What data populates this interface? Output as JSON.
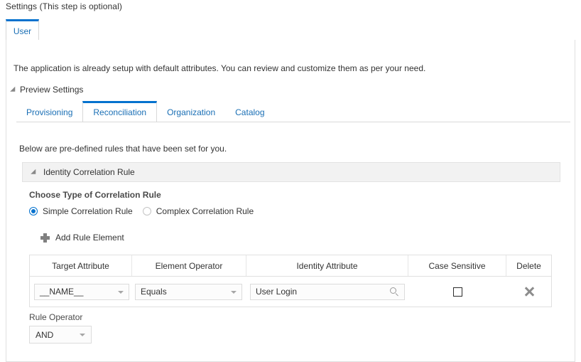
{
  "page": {
    "title": "Settings (This step is optional)"
  },
  "top_tabs": [
    {
      "label": "User",
      "active": true
    }
  ],
  "main": {
    "intro": "The application is already setup with default attributes. You can review and customize them as per your need.",
    "disclosure_label": "Preview Settings",
    "section_note": "Below are pre-defined rules that have been set for you."
  },
  "inner_tabs": [
    {
      "label": "Provisioning",
      "active": false
    },
    {
      "label": "Reconciliation",
      "active": true
    },
    {
      "label": "Organization",
      "active": false
    },
    {
      "label": "Catalog",
      "active": false
    }
  ],
  "rule_section": {
    "header_label": "Identity Correlation Rule",
    "choose_type_label": "Choose Type of Correlation Rule",
    "radios": [
      {
        "label": "Simple Correlation Rule",
        "selected": true
      },
      {
        "label": "Complex Correlation Rule",
        "selected": false
      }
    ],
    "add_rule_label": "Add Rule Element"
  },
  "rules_table": {
    "columns": [
      "Target Attribute",
      "Element Operator",
      "Identity Attribute",
      "Case Sensitive",
      "Delete"
    ],
    "rows": [
      {
        "target_attribute": "__NAME__",
        "element_operator": "Equals",
        "identity_attribute": "User Login",
        "case_sensitive": false
      }
    ]
  },
  "rule_operator": {
    "label": "Rule Operator",
    "value": "AND"
  },
  "colors": {
    "accent": "#0572ce",
    "link": "#1a6fb5",
    "text": "#333333",
    "panel_border": "#e0e0e0",
    "section_header_bg": "#f2f2f2"
  },
  "icons": {
    "disclosure": "triangle-collapse-icon",
    "add": "plus-icon",
    "search": "search-icon",
    "delete": "close-x-icon",
    "dropdown": "chevron-down-icon"
  }
}
